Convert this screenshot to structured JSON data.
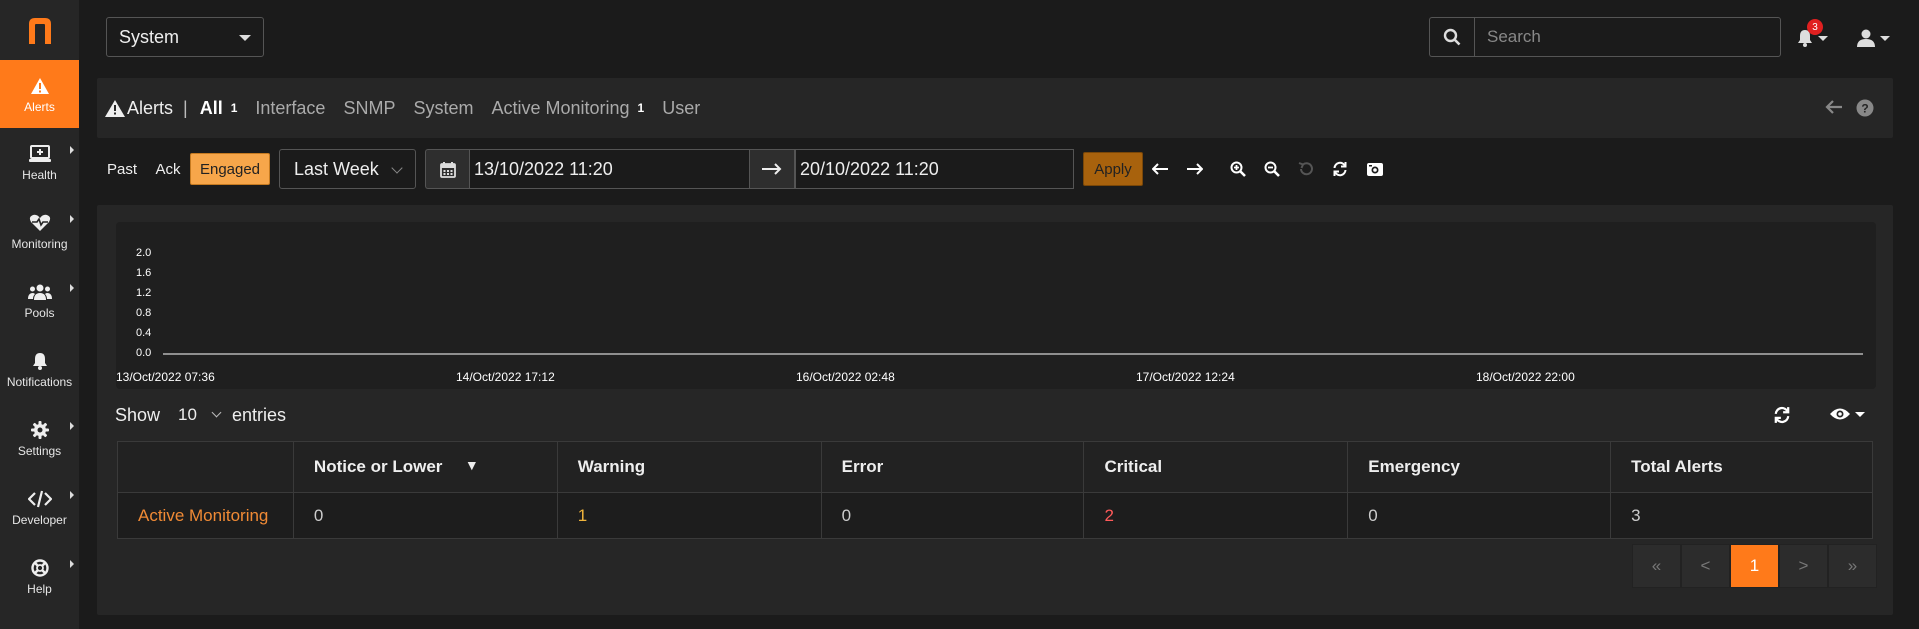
{
  "sidebar": {
    "items": [
      {
        "label": "Alerts",
        "icon": "warning-icon",
        "active": true
      },
      {
        "label": "Health",
        "icon": "monitor-plus-icon"
      },
      {
        "label": "Monitoring",
        "icon": "heartbeat-icon"
      },
      {
        "label": "Pools",
        "icon": "users-icon"
      },
      {
        "label": "Notifications",
        "icon": "bell-icon"
      },
      {
        "label": "Settings",
        "icon": "gear-icon"
      },
      {
        "label": "Developer",
        "icon": "code-icon"
      },
      {
        "label": "Help",
        "icon": "life-ring-icon"
      }
    ]
  },
  "topbar": {
    "system_select": "System",
    "search_placeholder": "Search",
    "notification_count": "3"
  },
  "tabs": {
    "title": "Alerts",
    "items": [
      {
        "label": "All",
        "count": "1"
      },
      {
        "label": "Interface",
        "count": ""
      },
      {
        "label": "SNMP",
        "count": ""
      },
      {
        "label": "System",
        "count": ""
      },
      {
        "label": "Active Monitoring",
        "count": "1"
      },
      {
        "label": "User",
        "count": ""
      }
    ]
  },
  "filters": {
    "past": "Past",
    "ack": "Ack",
    "engaged": "Engaged",
    "range": "Last Week",
    "from": "13/10/2022 11:20",
    "to": "20/10/2022 11:20",
    "apply": "Apply"
  },
  "chart_data": {
    "type": "line",
    "y_ticks": [
      "2.0",
      "1.6",
      "1.2",
      "0.8",
      "0.4",
      "0.0"
    ],
    "x_ticks": [
      "13/Oct/2022 07:36",
      "14/Oct/2022 17:12",
      "16/Oct/2022 02:48",
      "17/Oct/2022 12:24",
      "18/Oct/2022 22:00"
    ],
    "ylim": [
      0,
      2.0
    ],
    "series": [
      {
        "values": [
          0,
          0
        ]
      }
    ]
  },
  "table": {
    "show": "Show",
    "entries_value": "10",
    "entries": "entries",
    "headers": [
      "",
      "Notice or Lower",
      "Warning",
      "Error",
      "Critical",
      "Emergency",
      "Total Alerts"
    ],
    "sort_indicator": "▼",
    "rows": [
      [
        "Active Monitoring",
        "0",
        "1",
        "0",
        "2",
        "0",
        "3"
      ]
    ]
  },
  "pagination": {
    "first": "«",
    "prev": "<",
    "current": "1",
    "next": ">",
    "last": "»"
  },
  "colors": {
    "accent": "#ff7a1a",
    "warning": "#f0b43c",
    "critical": "#ff5a5a"
  }
}
